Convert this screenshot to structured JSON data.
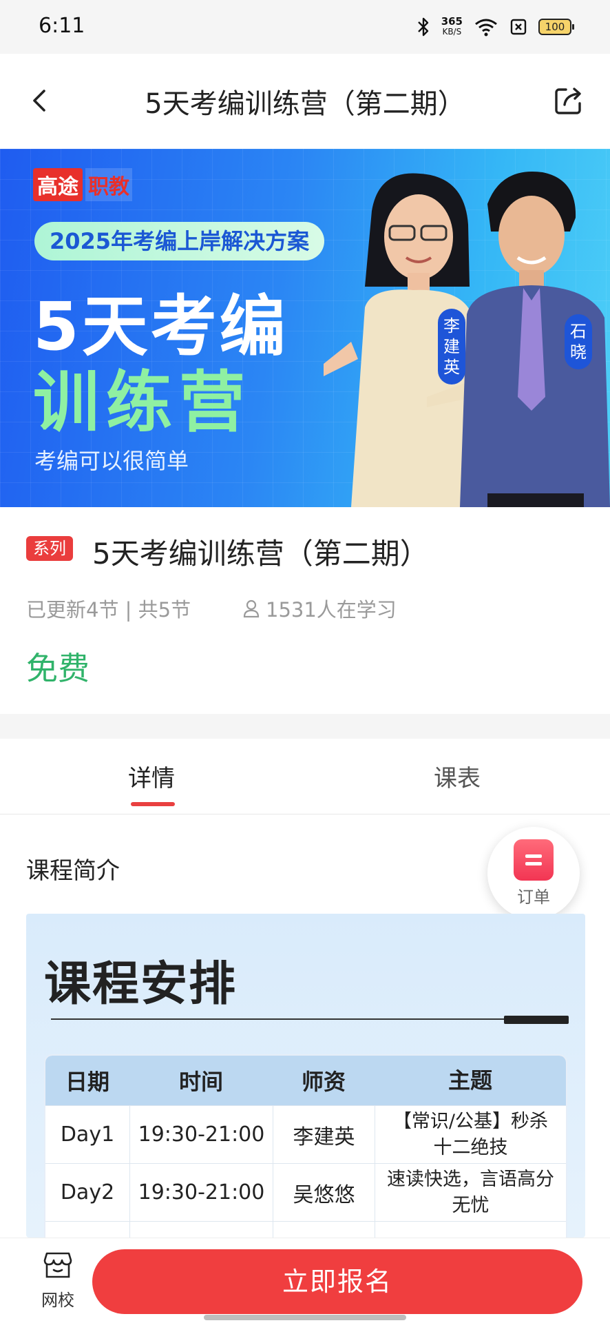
{
  "status_bar": {
    "time": "6:11",
    "speed_value": "365",
    "speed_unit": "KB/S",
    "battery": "100"
  },
  "nav": {
    "title": "5天考编训练营（第二期）",
    "back_icon": "chevron-left-icon",
    "share_icon": "share-icon"
  },
  "banner": {
    "brand_a": "高途",
    "brand_b": "职教",
    "pill": "2025年考编上岸解决方案",
    "headline_1": "5天考编",
    "headline_2": "训练营",
    "slogan": "考编可以很简单",
    "teacher_1": "李建英",
    "teacher_2": "石晓"
  },
  "course": {
    "badge": "系列",
    "title": "5天考编训练营（第二期）",
    "meta": "已更新4节 | 共5节",
    "learners": "1531人在学习",
    "price": "免费",
    "price_color": "#30b36a"
  },
  "tabs": [
    {
      "label": "详情",
      "active": true
    },
    {
      "label": "课表",
      "active": false
    }
  ],
  "intro": {
    "section_title": "课程简介",
    "schedule": {
      "title": "课程安排",
      "headers": [
        "日期",
        "时间",
        "师资",
        "主题"
      ],
      "rows": [
        {
          "date": "Day1",
          "time": "19:30-21:00",
          "teacher": "李建英",
          "topic": "【常识/公基】秒杀十二绝技"
        },
        {
          "date": "Day2",
          "time": "19:30-21:00",
          "teacher": "吴悠悠",
          "topic": "速读快选，言语高分无忧"
        }
      ]
    }
  },
  "order_float": {
    "label": "订单",
    "icon": "order-icon"
  },
  "bottom": {
    "school_label": "网校",
    "school_icon": "storefront-icon",
    "enroll_label": "立即报名",
    "accent": "#f03e3f"
  }
}
